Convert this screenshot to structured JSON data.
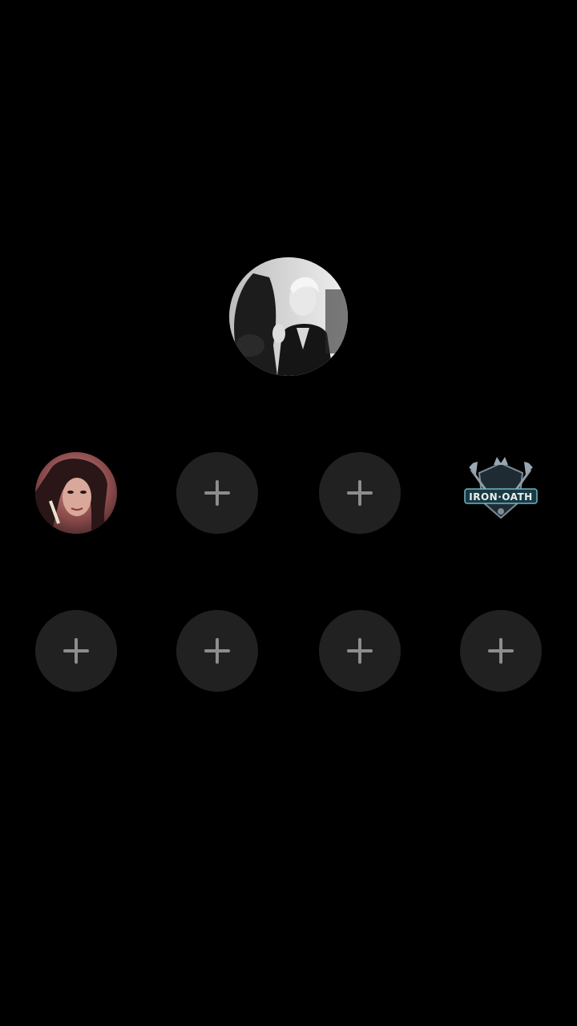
{
  "host": {
    "avatar_icon": "host-avatar-photo"
  },
  "seats": [
    {
      "index": 1,
      "state": "occupied",
      "icon": "user-avatar-photo"
    },
    {
      "index": 2,
      "state": "empty",
      "icon": "plus-icon"
    },
    {
      "index": 3,
      "state": "empty",
      "icon": "plus-icon"
    },
    {
      "index": 4,
      "state": "occupied",
      "icon": "iron-oath-logo",
      "logo_text": "IRON·OATH"
    },
    {
      "index": 5,
      "state": "empty",
      "icon": "plus-icon"
    },
    {
      "index": 6,
      "state": "empty",
      "icon": "plus-icon"
    },
    {
      "index": 7,
      "state": "empty",
      "icon": "plus-icon"
    },
    {
      "index": 8,
      "state": "empty",
      "icon": "plus-icon"
    }
  ],
  "colors": {
    "background": "#000000",
    "empty_seat": "#212121",
    "plus": "#8d8d8d"
  }
}
